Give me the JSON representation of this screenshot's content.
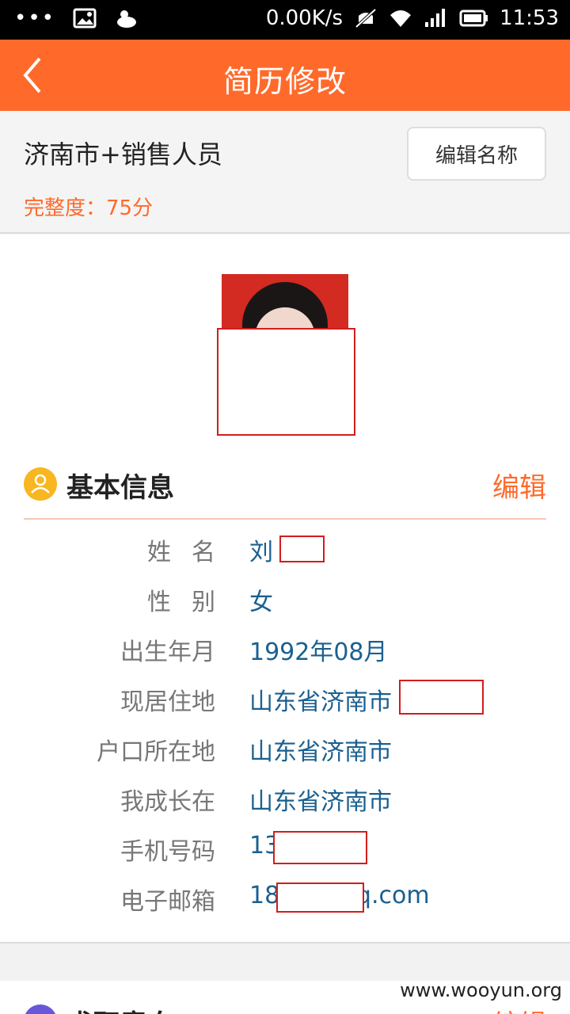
{
  "status_bar": {
    "network_speed": "0.00K/s",
    "time": "11:53",
    "icons": [
      "more-dots-icon",
      "image-icon",
      "weather-icon",
      "mute-icon",
      "wifi-icon",
      "signal-icon",
      "battery-icon"
    ]
  },
  "app_bar": {
    "title": "简历修改",
    "back_icon": "chevron-left-icon"
  },
  "resume": {
    "name": "济南市+销售人员",
    "edit_name_label": "编辑名称",
    "completeness": "完整度：75分"
  },
  "basic_info": {
    "title": "基本信息",
    "edit_label": "编辑",
    "rows": [
      {
        "label": "姓名",
        "value": "刘"
      },
      {
        "label": "性别",
        "value": "女"
      },
      {
        "label": "出生年月",
        "value": "1992年08月"
      },
      {
        "label": "现居住地",
        "value": "山东省济南市"
      },
      {
        "label": "户口所在地",
        "value": "山东省济南市"
      },
      {
        "label": "我成长在",
        "value": "山东省济南市"
      },
      {
        "label": "手机号码",
        "value": "13        985"
      },
      {
        "label": "电子邮箱",
        "value": "18        21@qq.com"
      }
    ]
  },
  "next_section": {
    "title": "求职意向",
    "edit_label": "编辑"
  },
  "watermark": "www.wooyun.org",
  "colors": {
    "accent": "#ff6a2b",
    "value_text": "#1a6090",
    "redaction_border": "#d21d1d"
  }
}
